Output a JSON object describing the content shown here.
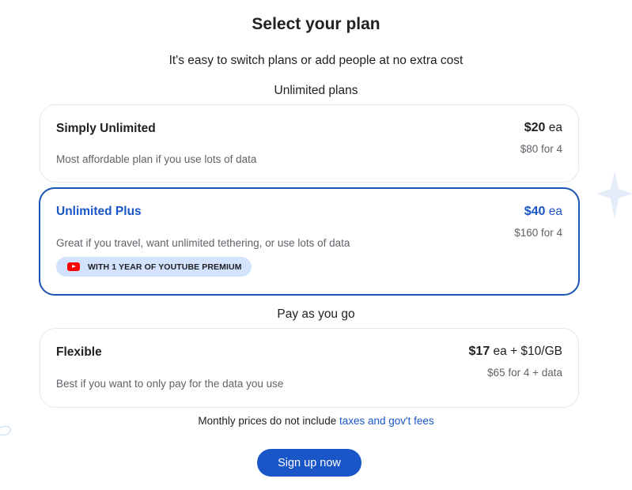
{
  "header": {
    "title": "Select your plan",
    "subtitle": "It's easy to switch plans or add people at no extra cost"
  },
  "sections": {
    "unlimited_label": "Unlimited plans",
    "payg_label": "Pay as you go"
  },
  "plans": [
    {
      "name": "Simply Unlimited",
      "description": "Most affordable plan if you use lots of data",
      "price_amount": "$20",
      "price_suffix": "ea",
      "sub_price": "$80 for 4",
      "selected": false
    },
    {
      "name": "Unlimited Plus",
      "description": "Great if you travel, want unlimited tethering, or use lots of data",
      "price_amount": "$40",
      "price_suffix": "ea",
      "sub_price": "$160 for 4",
      "promo": "WITH 1 YEAR OF YOUTUBE PREMIUM",
      "selected": true
    },
    {
      "name": "Flexible",
      "description": "Best if you want to only pay for the data you use",
      "price_amount": "$17",
      "price_suffix": "ea + $10/GB",
      "sub_price": "$65 for 4 + data",
      "selected": false
    }
  ],
  "footer": {
    "note": "Monthly prices do not include ",
    "link": "taxes and gov't fees",
    "cta": "Sign up now"
  },
  "colors": {
    "accent": "#1a56c8",
    "selected_border": "#1b55b0",
    "promo_bg": "#d3e3fd",
    "youtube_red": "#ff0000",
    "decoration": "#e3ecf8"
  },
  "icons": {
    "promo_icon": "youtube-icon",
    "decoration_right": "sparkle-icon",
    "decoration_left": "swirl-icon"
  }
}
